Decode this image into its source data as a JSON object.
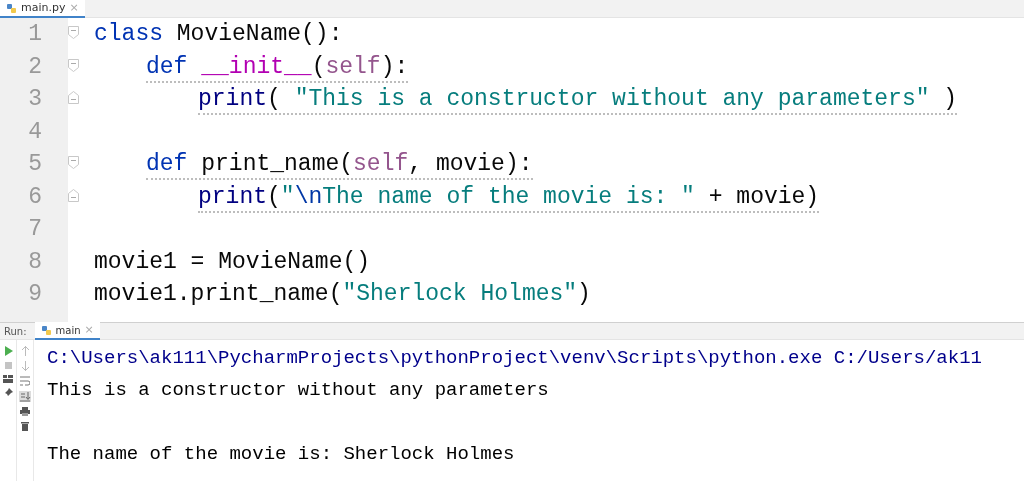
{
  "editor_tabs": [
    {
      "label": "main.py",
      "selected": true,
      "close": "×"
    }
  ],
  "code_lines": [
    {
      "number": "1",
      "warning": false,
      "tokens": [
        {
          "kind": "keyword",
          "text": "class"
        },
        {
          "kind": "plain",
          "text": " MovieName():"
        }
      ],
      "children": [
        {
          "number": "2",
          "warning": true,
          "tokens": [
            {
              "kind": "keyword",
              "text": "def "
            },
            {
              "kind": "magic",
              "text": "__init__"
            },
            {
              "kind": "plain",
              "text": "("
            },
            {
              "kind": "self",
              "text": "self"
            },
            {
              "kind": "plain",
              "text": "):"
            }
          ],
          "children": [
            {
              "number": "3",
              "warning": true,
              "tokens": [
                {
                  "kind": "builtin",
                  "text": "print"
                },
                {
                  "kind": "plain",
                  "text": "( "
                },
                {
                  "kind": "string",
                  "text": "\"This is a constructor without any parameters\""
                },
                {
                  "kind": "plain",
                  "text": " )"
                }
              ]
            }
          ]
        },
        {
          "number": "4"
        },
        {
          "number": "5",
          "warning": true,
          "tokens": [
            {
              "kind": "keyword",
              "text": "def"
            },
            {
              "kind": "plain",
              "text": " print_name("
            },
            {
              "kind": "self",
              "text": "self"
            },
            {
              "kind": "plain",
              "text": ", movie):"
            }
          ],
          "children": [
            {
              "number": "6",
              "warning": true,
              "tokens": [
                {
                  "kind": "builtin",
                  "text": "print"
                },
                {
                  "kind": "plain",
                  "text": "("
                },
                {
                  "kind": "string",
                  "text": "\""
                },
                {
                  "kind": "escape",
                  "text": "\\n"
                },
                {
                  "kind": "string",
                  "text": "The name of the movie is: \""
                },
                {
                  "kind": "plain",
                  "text": " + movie)"
                }
              ]
            }
          ]
        }
      ]
    },
    {
      "number": "7"
    },
    {
      "number": "8",
      "warning": false,
      "tokens": [
        {
          "kind": "plain",
          "text": "movie1 = MovieName()"
        }
      ]
    },
    {
      "number": "9",
      "warning": false,
      "tokens": [
        {
          "kind": "plain",
          "text": "movie1.print_name("
        },
        {
          "kind": "string",
          "text": "\"Sherlock Holmes\""
        },
        {
          "kind": "plain",
          "text": ")"
        }
      ]
    }
  ],
  "run_panel": {
    "label": "Run:",
    "tabs": [
      {
        "label": "main",
        "selected": true,
        "close": "×"
      }
    ],
    "output": [
      {
        "kind": "command",
        "text": "C:\\Users\\ak111\\PycharmProjects\\pythonProject\\venv\\Scripts\\python.exe C:/Users/ak11"
      },
      {
        "kind": "stdout",
        "text": "This is a constructor without any parameters"
      },
      {
        "kind": "blank"
      },
      {
        "kind": "stdout",
        "text": "The name of the movie is: Sherlock Holmes"
      }
    ]
  }
}
